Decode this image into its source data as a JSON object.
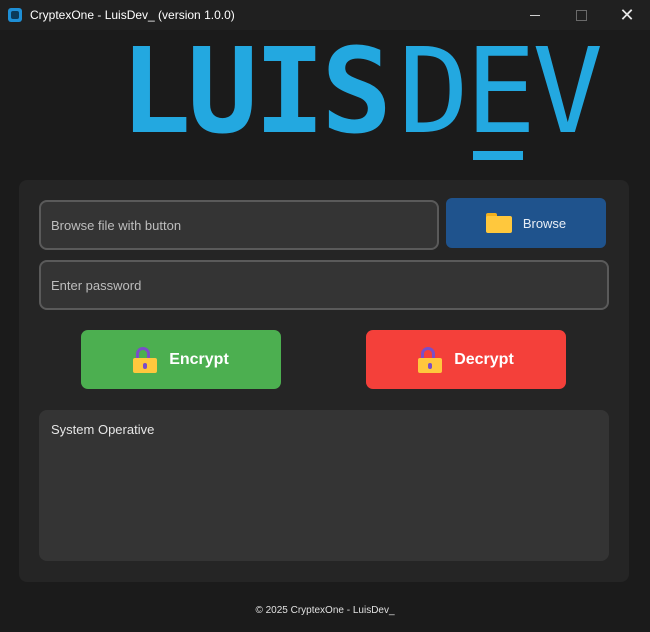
{
  "window": {
    "title": "CryptexOne - LuisDev_ (version 1.0.0)",
    "minimize_glyph": "",
    "maximize_glyph": "",
    "close_glyph": "✕"
  },
  "logo": {
    "bold_text": "LUIS",
    "light_text": "DEV",
    "color": "#23a8e0"
  },
  "form": {
    "file_placeholder": "Browse file with button",
    "password_placeholder": "Enter password",
    "browse_label": "Browse"
  },
  "actions": {
    "encrypt_label": "Encrypt",
    "decrypt_label": "Decrypt",
    "encrypt_color": "#4caf50",
    "decrypt_color": "#f4403a"
  },
  "log": {
    "status_text": "System Operative"
  },
  "footer": {
    "text": "© 2025 CryptexOne - LuisDev_"
  },
  "icons": {
    "app": "app-icon",
    "folder": "folder-icon",
    "lock": "lock-icon"
  }
}
